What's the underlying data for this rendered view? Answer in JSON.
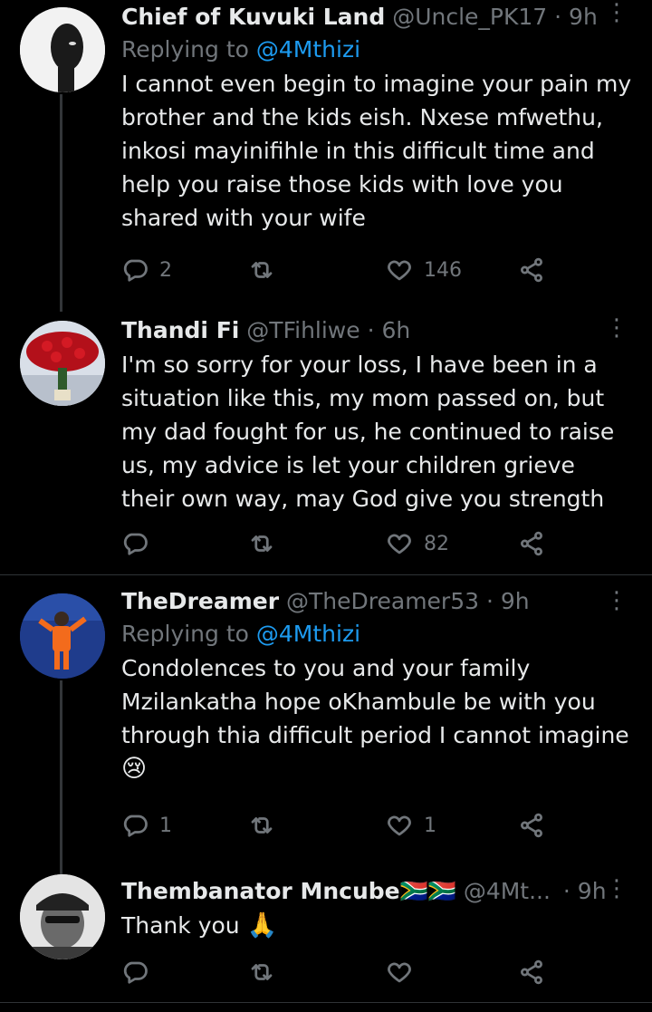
{
  "tweets": [
    {
      "display_name": "Chief of Kuvuki Land",
      "handle": "@Uncle_PK17",
      "time": "· 9h",
      "replying_prefix": "Replying to",
      "replying_to": "@4Mthizi",
      "text": "I cannot even begin to imagine your pain my brother and the kids eish. Nxese mfwethu, inkosi mayinifihle in this difficult time and help you raise those kids with love you shared with your wife",
      "replies": "2",
      "retweets": "",
      "likes": "146",
      "avatar": "avatar-man-portrait"
    },
    {
      "display_name": "Thandi Fi",
      "handle": "@TFihliwe",
      "time": "· 6h",
      "text": "I'm so sorry for your loss, I have been in a situation like this, my mom passed on, but my dad fought for us, he continued to raise us, my advice is let your children grieve their own way, may God give you strength",
      "replies": "",
      "retweets": "",
      "likes": "82",
      "avatar": "avatar-red-roses"
    },
    {
      "display_name": "TheDreamer",
      "handle": "@TheDreamer53",
      "time": "· 9h",
      "replying_prefix": "Replying to",
      "replying_to": "@4Mthizi",
      "text": "Condolences  to you and your family Mzilankatha hope oKhambule be with you through thia difficult period I cannot imagine",
      "emoji": "😢",
      "replies": "1",
      "retweets": "",
      "likes": "1",
      "avatar": "avatar-goalkeeper"
    },
    {
      "display_name": "Thembanator Mncube",
      "flags": "🇿🇦🇿🇦",
      "handle": "@4Mt...",
      "time": "· 9h",
      "text": "Thank you",
      "emoji": "🙏",
      "replies": "",
      "retweets": "",
      "likes": "",
      "avatar": "avatar-man-cap"
    }
  ],
  "colors": {
    "background": "#000000",
    "text": "#e7e9ea",
    "muted": "#71767b",
    "link": "#1d9bf0",
    "divider": "#2f3336"
  },
  "icons": {
    "more": "more-vertical-icon",
    "reply": "reply-icon",
    "retweet": "retweet-icon",
    "like": "heart-icon",
    "share": "share-icon"
  }
}
